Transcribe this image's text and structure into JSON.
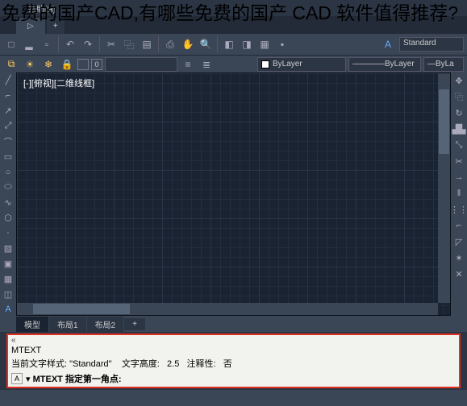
{
  "overlay_title": "免费的国产CAD,有哪些免费的国产 CAD 软件值得推荐?",
  "menu": {
    "help": "帮助(H)"
  },
  "tabs": {
    "active": "▷",
    "plus": "+"
  },
  "style_box": "Standard",
  "props": {
    "zero": "0",
    "bylayer1": "ByLayer",
    "bylayer2": "ByLayer",
    "byla": "ByLa"
  },
  "canvas": {
    "label": "[-][俯视][二维线框]"
  },
  "layout": {
    "model": "模型",
    "l1": "布局1",
    "l2": "布局2",
    "plus": "+"
  },
  "cmd": {
    "scroll": "«",
    "line1": "MTEXT",
    "line2_pre": "当前文字样式: \"Standard\"",
    "line2_h": "文字高度:",
    "line2_hv": "2.5",
    "line2_a": "注释性:",
    "line2_av": "否",
    "a_icon": "A",
    "arrow": "▾",
    "prompt": "MTEXT 指定第一角点:"
  }
}
